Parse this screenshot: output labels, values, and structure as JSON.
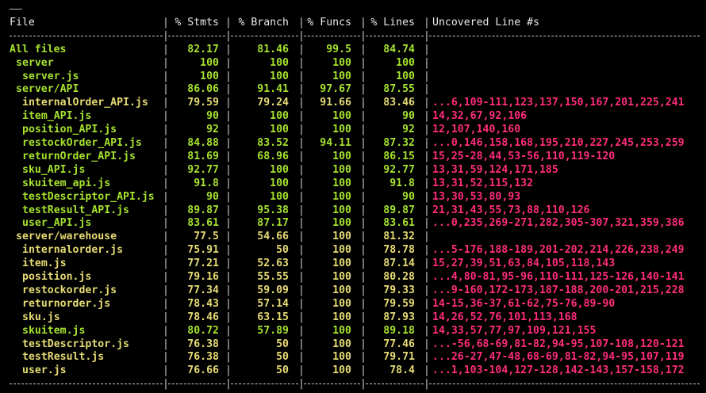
{
  "top_rule": "——",
  "header": {
    "file": "File",
    "stmts": "% Stmts",
    "branch": "% Branch",
    "funcs": "% Funcs",
    "lines": "% Lines",
    "uncovered": "Uncovered Line #s"
  },
  "colors": {
    "high": "#a6e22e",
    "medium": "#e6db74",
    "low": "#ff2d7a",
    "text": "#e8e8e8",
    "rule": "#c9c9c9"
  },
  "rows": [
    {
      "file": "All files",
      "indent": 0,
      "stmts": "82.17",
      "branch": "81.46",
      "funcs": "99.5",
      "lines": "84.74",
      "uncovered": "",
      "color": "high"
    },
    {
      "file": "server",
      "indent": 1,
      "stmts": "100",
      "branch": "100",
      "funcs": "100",
      "lines": "100",
      "uncovered": "",
      "color": "high"
    },
    {
      "file": "server.js",
      "indent": 2,
      "stmts": "100",
      "branch": "100",
      "funcs": "100",
      "lines": "100",
      "uncovered": "",
      "color": "high"
    },
    {
      "file": "server/API",
      "indent": 1,
      "stmts": "86.06",
      "branch": "91.41",
      "funcs": "97.67",
      "lines": "87.55",
      "uncovered": "",
      "color": "high"
    },
    {
      "file": "internalOrder_API.js",
      "indent": 2,
      "stmts": "79.59",
      "branch": "79.24",
      "funcs": "91.66",
      "lines": "83.46",
      "uncovered": "...6,109-111,123,137,150,167,201,225,241",
      "color": "medium"
    },
    {
      "file": "item_API.js",
      "indent": 2,
      "stmts": "90",
      "branch": "100",
      "funcs": "100",
      "lines": "90",
      "uncovered": "14,32,67,92,106",
      "color": "high"
    },
    {
      "file": "position_API.js",
      "indent": 2,
      "stmts": "92",
      "branch": "100",
      "funcs": "100",
      "lines": "92",
      "uncovered": "12,107,140,160",
      "color": "high"
    },
    {
      "file": "restockOrder_API.js",
      "indent": 2,
      "stmts": "84.88",
      "branch": "83.52",
      "funcs": "94.11",
      "lines": "87.32",
      "uncovered": "...0,146,158,168,195,210,227,245,253,259",
      "color": "high"
    },
    {
      "file": "returnOrder_API.js",
      "indent": 2,
      "stmts": "81.69",
      "branch": "68.96",
      "funcs": "100",
      "lines": "86.15",
      "uncovered": "15,25-28,44,53-56,110,119-120",
      "color": "high"
    },
    {
      "file": "sku_API.js",
      "indent": 2,
      "stmts": "92.77",
      "branch": "100",
      "funcs": "100",
      "lines": "92.77",
      "uncovered": "13,31,59,124,171,185",
      "color": "high"
    },
    {
      "file": "skuitem_api.js",
      "indent": 2,
      "stmts": "91.8",
      "branch": "100",
      "funcs": "100",
      "lines": "91.8",
      "uncovered": "13,31,52,115,132",
      "color": "high"
    },
    {
      "file": "testDescriptor_API.js",
      "indent": 2,
      "stmts": "90",
      "branch": "100",
      "funcs": "100",
      "lines": "90",
      "uncovered": "13,30,53,80,93",
      "color": "high"
    },
    {
      "file": "testResult_API.js",
      "indent": 2,
      "stmts": "89.87",
      "branch": "95.38",
      "funcs": "100",
      "lines": "89.87",
      "uncovered": "21,31,43,55,73,88,110,126",
      "color": "high"
    },
    {
      "file": "user_API.js",
      "indent": 2,
      "stmts": "83.61",
      "branch": "87.17",
      "funcs": "100",
      "lines": "83.61",
      "uncovered": "...0,235,269-271,282,305-307,321,359,386",
      "color": "high"
    },
    {
      "file": "server/warehouse",
      "indent": 1,
      "stmts": "77.5",
      "branch": "54.66",
      "funcs": "100",
      "lines": "81.32",
      "uncovered": "",
      "color": "medium"
    },
    {
      "file": "internalorder.js",
      "indent": 2,
      "stmts": "75.91",
      "branch": "50",
      "funcs": "100",
      "lines": "78.78",
      "uncovered": "...5-176,188-189,201-202,214,226,238,249",
      "color": "medium"
    },
    {
      "file": "item.js",
      "indent": 2,
      "stmts": "77.21",
      "branch": "52.63",
      "funcs": "100",
      "lines": "87.14",
      "uncovered": "15,27,39,51,63,84,105,118,143",
      "color": "medium"
    },
    {
      "file": "position.js",
      "indent": 2,
      "stmts": "79.16",
      "branch": "55.55",
      "funcs": "100",
      "lines": "80.28",
      "uncovered": "...4,80-81,95-96,110-111,125-126,140-141",
      "color": "medium"
    },
    {
      "file": "restockorder.js",
      "indent": 2,
      "stmts": "77.34",
      "branch": "59.09",
      "funcs": "100",
      "lines": "79.33",
      "uncovered": "...9-160,172-173,187-188,200-201,215,228",
      "color": "medium"
    },
    {
      "file": "returnorder.js",
      "indent": 2,
      "stmts": "78.43",
      "branch": "57.14",
      "funcs": "100",
      "lines": "79.59",
      "uncovered": "14-15,36-37,61-62,75-76,89-90",
      "color": "medium"
    },
    {
      "file": "sku.js",
      "indent": 2,
      "stmts": "78.46",
      "branch": "63.15",
      "funcs": "100",
      "lines": "87.93",
      "uncovered": "14,26,52,76,101,113,168",
      "color": "medium"
    },
    {
      "file": "skuitem.js",
      "indent": 2,
      "stmts": "80.72",
      "branch": "57.89",
      "funcs": "100",
      "lines": "89.18",
      "uncovered": "14,33,57,77,97,109,121,155",
      "color": "high"
    },
    {
      "file": "testDescriptor.js",
      "indent": 2,
      "stmts": "76.38",
      "branch": "50",
      "funcs": "100",
      "lines": "77.46",
      "uncovered": "...-56,68-69,81-82,94-95,107-108,120-121",
      "color": "medium"
    },
    {
      "file": "testResult.js",
      "indent": 2,
      "stmts": "76.38",
      "branch": "50",
      "funcs": "100",
      "lines": "79.71",
      "uncovered": "...26-27,47-48,68-69,81-82,94-95,107,119",
      "color": "medium"
    },
    {
      "file": "user.js",
      "indent": 2,
      "stmts": "76.66",
      "branch": "50",
      "funcs": "100",
      "lines": "78.4",
      "uncovered": "...1,103-104,127-128,142-143,157-158,172",
      "color": "medium"
    }
  ]
}
